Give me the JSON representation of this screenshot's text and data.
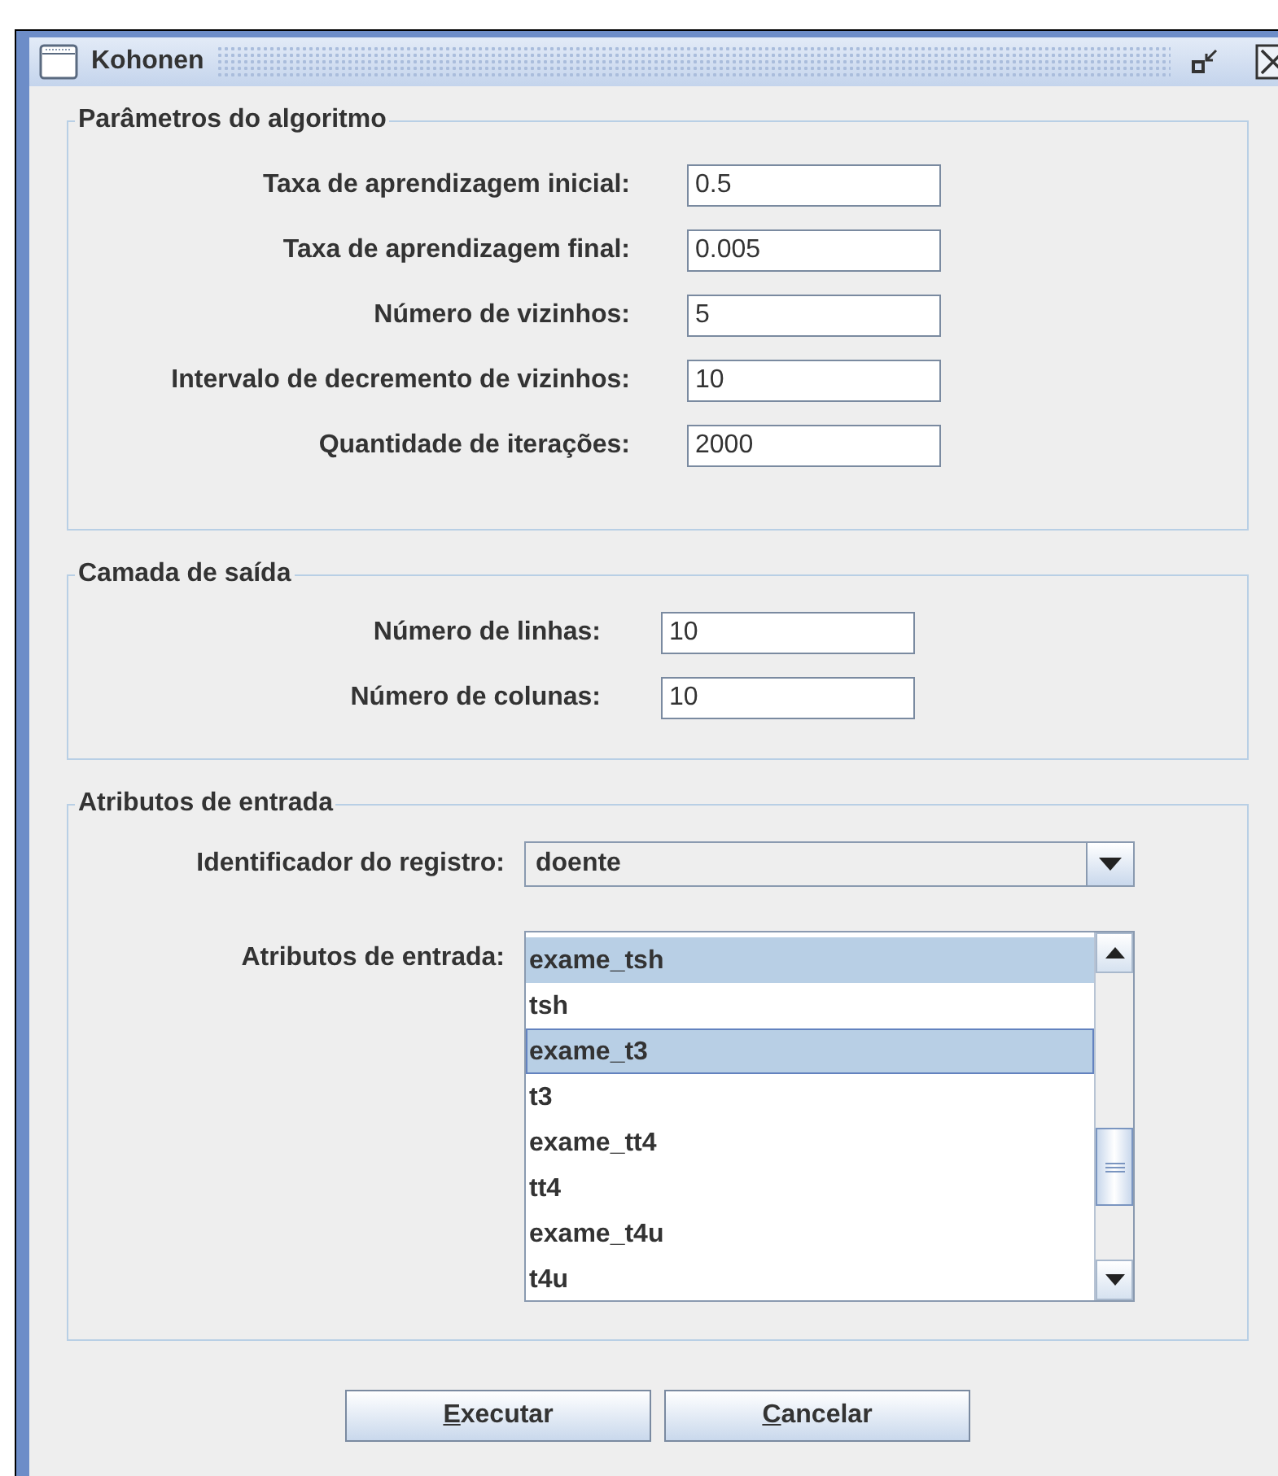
{
  "window": {
    "title": "Kohonen"
  },
  "sections": [
    {
      "title": "Parâmetros do algoritmo",
      "kind": "fields",
      "fields": [
        {
          "label": "Taxa de aprendizagem inicial:",
          "value": "0.5"
        },
        {
          "label": "Taxa de aprendizagem final:",
          "value": "0.005"
        },
        {
          "label": "Número de vizinhos:",
          "value": "5"
        },
        {
          "label": "Intervalo de decremento de vizinhos:",
          "value": "10"
        },
        {
          "label": "Quantidade de iterações:",
          "value": "2000"
        }
      ]
    },
    {
      "title": "Camada de saída",
      "kind": "fields",
      "fields": [
        {
          "label": "Número de linhas:",
          "value": "10"
        },
        {
          "label": "Número de colunas:",
          "value": "10"
        }
      ]
    },
    {
      "title": "Atributos de entrada",
      "kind": "attributes",
      "combo": {
        "label": "Identificador do registro:",
        "value": "doente"
      },
      "list": {
        "label": "Atributos de entrada:",
        "items": [
          {
            "text": "exame_tsh",
            "selected": true,
            "focused": false
          },
          {
            "text": "tsh",
            "selected": false,
            "focused": false
          },
          {
            "text": "exame_t3",
            "selected": true,
            "focused": true
          },
          {
            "text": "t3",
            "selected": false,
            "focused": false
          },
          {
            "text": "exame_tt4",
            "selected": false,
            "focused": false
          },
          {
            "text": "tt4",
            "selected": false,
            "focused": false
          },
          {
            "text": "exame_t4u",
            "selected": false,
            "focused": false
          },
          {
            "text": "t4u",
            "selected": false,
            "focused": false
          }
        ]
      }
    }
  ],
  "buttons": [
    {
      "label": "Executar",
      "mnemonic_underlined": true
    },
    {
      "label": "Cancelar",
      "mnemonic_underlined": true
    }
  ]
}
